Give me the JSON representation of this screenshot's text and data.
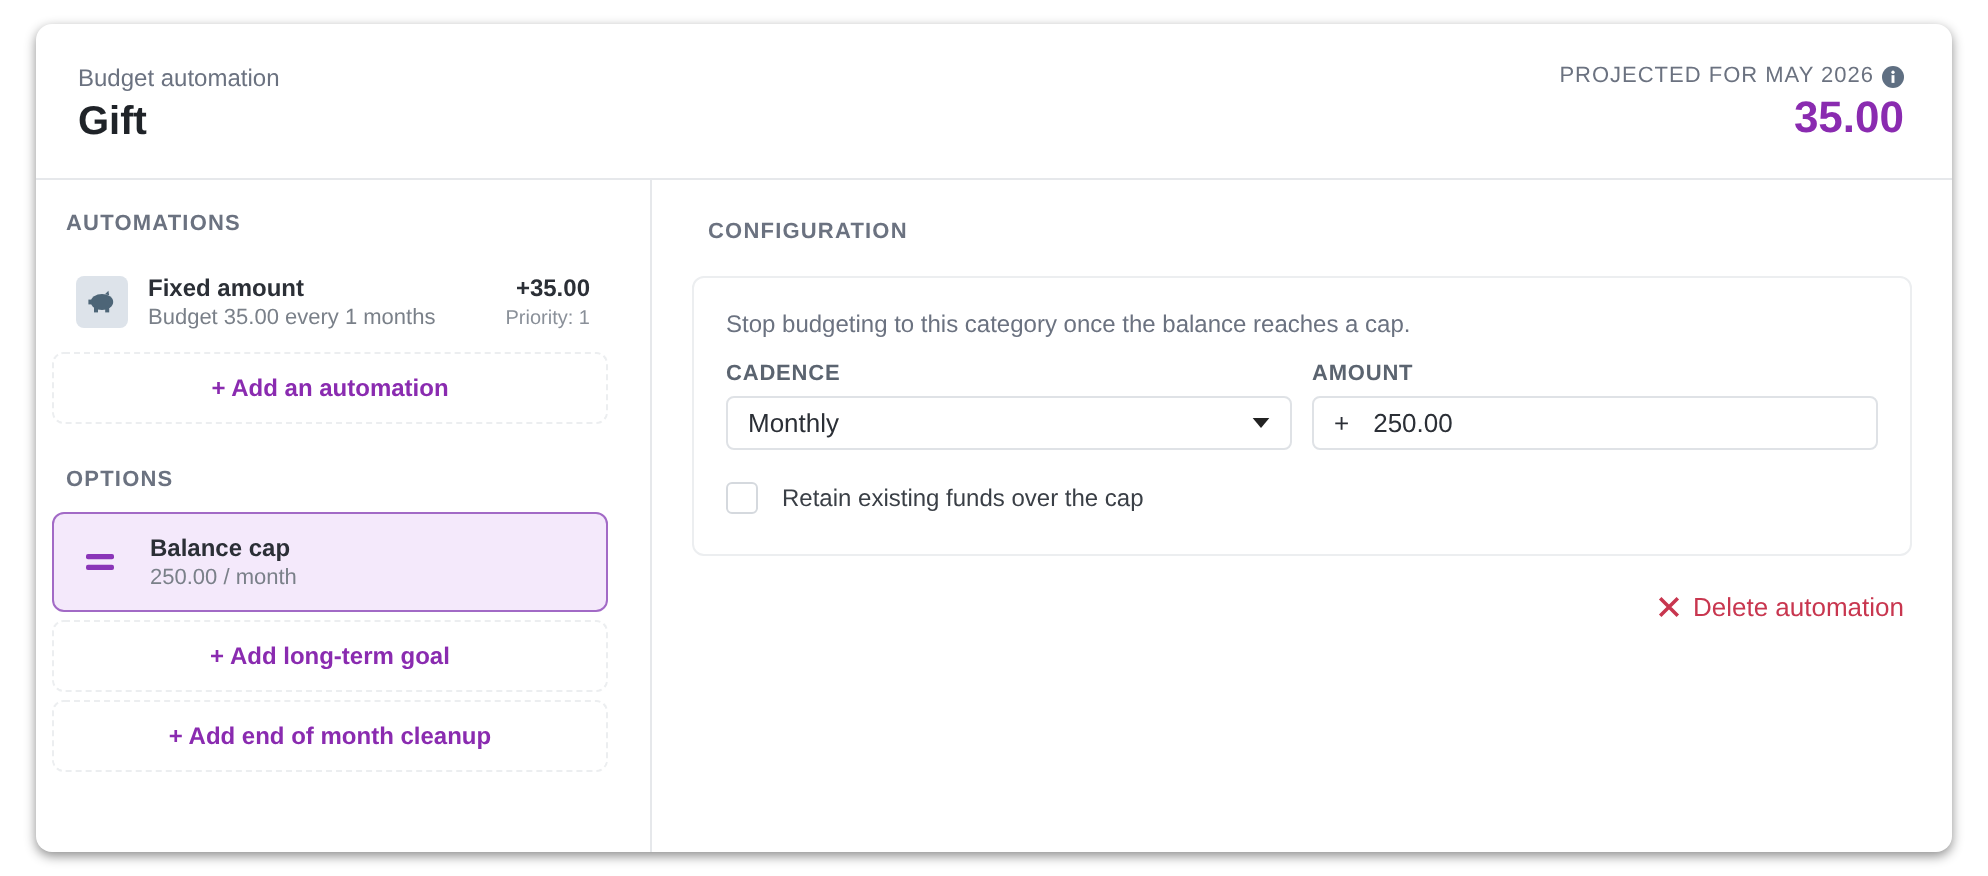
{
  "header": {
    "subtitle": "Budget automation",
    "title": "Gift",
    "projected_label": "PROJECTED FOR MAY 2026",
    "projected_value": "35.00"
  },
  "automations": {
    "heading": "AUTOMATIONS",
    "items": [
      {
        "title": "Fixed amount",
        "subtitle": "Budget 35.00 every 1 months",
        "amount": "+35.00",
        "priority": "Priority: 1",
        "selected": false
      }
    ],
    "add_button": "+ Add an automation"
  },
  "options": {
    "heading": "OPTIONS",
    "items": [
      {
        "title": "Balance cap",
        "subtitle": "250.00 / month",
        "selected": true
      }
    ],
    "add_buttons": [
      "+ Add long-term goal",
      "+ Add end of month cleanup"
    ]
  },
  "configuration": {
    "heading": "CONFIGURATION",
    "description": "Stop budgeting to this category once the balance reaches a cap.",
    "cadence": {
      "label": "CADENCE",
      "value": "Monthly"
    },
    "amount": {
      "label": "AMOUNT",
      "prefix": "+",
      "value": "250.00"
    },
    "retain": {
      "label": "Retain existing funds over the cap",
      "checked": false
    },
    "delete_button": "Delete automation"
  }
}
